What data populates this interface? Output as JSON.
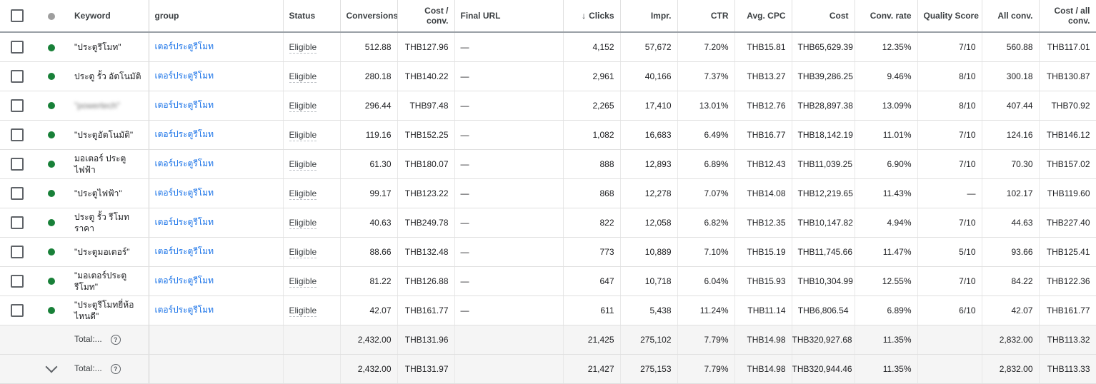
{
  "header": {
    "keyword": "Keyword",
    "ad_group": "group",
    "status": "Status",
    "conversions": "Conversions",
    "cost_per_conv": "Cost / conv.",
    "final_url": "Final URL",
    "clicks_arrow": "↓",
    "clicks": "Clicks",
    "impr": "Impr.",
    "ctr": "CTR",
    "avg_cpc": "Avg. CPC",
    "cost": "Cost",
    "conv_rate": "Conv. rate",
    "quality_score": "Quality Score",
    "all_conv": "All conv.",
    "cost_all_conv": "Cost / all conv."
  },
  "colors": {
    "enabled_dot": "#188038",
    "header_dot": "#9e9e9e",
    "link": "#1a73e8"
  },
  "rows": [
    {
      "keyword": "\"ประตูรีโมท\"",
      "ad_group": "เตอร์ประตูรีโมท",
      "status": "Eligible",
      "conversions": "512.88",
      "cost_per_conv": "THB127.96",
      "final_url": "—",
      "clicks": "4,152",
      "impr": "57,672",
      "ctr": "7.20%",
      "avg_cpc": "THB15.81",
      "cost": "THB65,629.39",
      "conv_rate": "12.35%",
      "quality_score": "7/10",
      "all_conv": "560.88",
      "cost_all_conv": "THB117.01"
    },
    {
      "keyword": "ประตู รั้ว อัตโนมัติ",
      "ad_group": "เตอร์ประตูรีโมท",
      "status": "Eligible",
      "conversions": "280.18",
      "cost_per_conv": "THB140.22",
      "final_url": "—",
      "clicks": "2,961",
      "impr": "40,166",
      "ctr": "7.37%",
      "avg_cpc": "THB13.27",
      "cost": "THB39,286.25",
      "conv_rate": "9.46%",
      "quality_score": "8/10",
      "all_conv": "300.18",
      "cost_all_conv": "THB130.87"
    },
    {
      "keyword": "\"powertech\"",
      "ad_group": "เตอร์ประตูรีโมท",
      "status": "Eligible",
      "conversions": "296.44",
      "cost_per_conv": "THB97.48",
      "final_url": "—",
      "clicks": "2,265",
      "impr": "17,410",
      "ctr": "13.01%",
      "avg_cpc": "THB12.76",
      "cost": "THB28,897.38",
      "conv_rate": "13.09%",
      "quality_score": "8/10",
      "all_conv": "407.44",
      "cost_all_conv": "THB70.92"
    },
    {
      "keyword": "\"ประตูอัตโนมัติ\"",
      "ad_group": "เตอร์ประตูรีโมท",
      "status": "Eligible",
      "conversions": "119.16",
      "cost_per_conv": "THB152.25",
      "final_url": "—",
      "clicks": "1,082",
      "impr": "16,683",
      "ctr": "6.49%",
      "avg_cpc": "THB16.77",
      "cost": "THB18,142.19",
      "conv_rate": "11.01%",
      "quality_score": "7/10",
      "all_conv": "124.16",
      "cost_all_conv": "THB146.12"
    },
    {
      "keyword": "มอเตอร์ ประตู ไฟฟ้า",
      "ad_group": "เตอร์ประตูรีโมท",
      "status": "Eligible",
      "conversions": "61.30",
      "cost_per_conv": "THB180.07",
      "final_url": "—",
      "clicks": "888",
      "impr": "12,893",
      "ctr": "6.89%",
      "avg_cpc": "THB12.43",
      "cost": "THB11,039.25",
      "conv_rate": "6.90%",
      "quality_score": "7/10",
      "all_conv": "70.30",
      "cost_all_conv": "THB157.02"
    },
    {
      "keyword": "\"ประตูไฟฟ้า\"",
      "ad_group": "เตอร์ประตูรีโมท",
      "status": "Eligible",
      "conversions": "99.17",
      "cost_per_conv": "THB123.22",
      "final_url": "—",
      "clicks": "868",
      "impr": "12,278",
      "ctr": "7.07%",
      "avg_cpc": "THB14.08",
      "cost": "THB12,219.65",
      "conv_rate": "11.43%",
      "quality_score": "—",
      "all_conv": "102.17",
      "cost_all_conv": "THB119.60"
    },
    {
      "keyword": "ประตู รั้ว รีโมท ราคา",
      "ad_group": "เตอร์ประตูรีโมท",
      "status": "Eligible",
      "conversions": "40.63",
      "cost_per_conv": "THB249.78",
      "final_url": "—",
      "clicks": "822",
      "impr": "12,058",
      "ctr": "6.82%",
      "avg_cpc": "THB12.35",
      "cost": "THB10,147.82",
      "conv_rate": "4.94%",
      "quality_score": "7/10",
      "all_conv": "44.63",
      "cost_all_conv": "THB227.40"
    },
    {
      "keyword": "\"ประตูมอเตอร์\"",
      "ad_group": "เตอร์ประตูรีโมท",
      "status": "Eligible",
      "conversions": "88.66",
      "cost_per_conv": "THB132.48",
      "final_url": "—",
      "clicks": "773",
      "impr": "10,889",
      "ctr": "7.10%",
      "avg_cpc": "THB15.19",
      "cost": "THB11,745.66",
      "conv_rate": "11.47%",
      "quality_score": "5/10",
      "all_conv": "93.66",
      "cost_all_conv": "THB125.41"
    },
    {
      "keyword": "\"มอเตอร์ประตู รีโมท\"",
      "ad_group": "เตอร์ประตูรีโมท",
      "status": "Eligible",
      "conversions": "81.22",
      "cost_per_conv": "THB126.88",
      "final_url": "—",
      "clicks": "647",
      "impr": "10,718",
      "ctr": "6.04%",
      "avg_cpc": "THB15.93",
      "cost": "THB10,304.99",
      "conv_rate": "12.55%",
      "quality_score": "7/10",
      "all_conv": "84.22",
      "cost_all_conv": "THB122.36"
    },
    {
      "keyword": "\"ประตูรีโมทยี่ห้อ ไหนดี\"",
      "ad_group": "เตอร์ประตูรีโมท",
      "status": "Eligible",
      "conversions": "42.07",
      "cost_per_conv": "THB161.77",
      "final_url": "—",
      "clicks": "611",
      "impr": "5,438",
      "ctr": "11.24%",
      "avg_cpc": "THB11.14",
      "cost": "THB6,806.54",
      "conv_rate": "6.89%",
      "quality_score": "6/10",
      "all_conv": "42.07",
      "cost_all_conv": "THB161.77"
    }
  ],
  "totals": [
    {
      "label": "Total:...",
      "conversions": "2,432.00",
      "cost_per_conv": "THB131.96",
      "clicks": "21,425",
      "impr": "275,102",
      "ctr": "7.79%",
      "avg_cpc": "THB14.98",
      "cost": "THB320,927.68",
      "conv_rate": "11.35%",
      "all_conv": "2,832.00",
      "cost_all_conv": "THB113.32"
    },
    {
      "label": "Total:...",
      "conversions": "2,432.00",
      "cost_per_conv": "THB131.97",
      "clicks": "21,427",
      "impr": "275,153",
      "ctr": "7.79%",
      "avg_cpc": "THB14.98",
      "cost": "THB320,944.46",
      "conv_rate": "11.35%",
      "all_conv": "2,832.00",
      "cost_all_conv": "THB113.33"
    }
  ]
}
